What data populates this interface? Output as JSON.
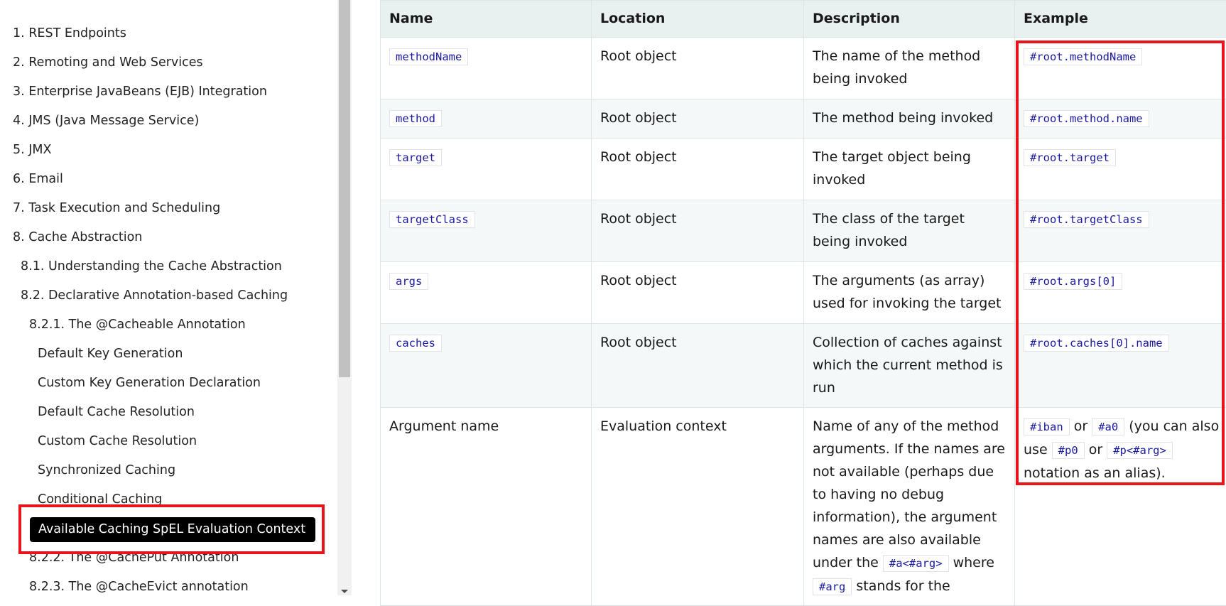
{
  "sidebar": {
    "items": [
      {
        "label": "1. REST Endpoints",
        "level": 1
      },
      {
        "label": "2. Remoting and Web Services",
        "level": 1
      },
      {
        "label": "3. Enterprise JavaBeans (EJB) Integration",
        "level": 1
      },
      {
        "label": "4. JMS (Java Message Service)",
        "level": 1
      },
      {
        "label": "5. JMX",
        "level": 1
      },
      {
        "label": "6. Email",
        "level": 1
      },
      {
        "label": "7. Task Execution and Scheduling",
        "level": 1
      },
      {
        "label": "8. Cache Abstraction",
        "level": 1
      },
      {
        "label": "8.1. Understanding the Cache Abstraction",
        "level": 2
      },
      {
        "label": "8.2. Declarative Annotation-based Caching",
        "level": 2
      },
      {
        "label": "8.2.1. The @Cacheable Annotation",
        "level": 3
      },
      {
        "label": "Default Key Generation",
        "level": 4
      },
      {
        "label": "Custom Key Generation Declaration",
        "level": 4
      },
      {
        "label": "Default Cache Resolution",
        "level": 4
      },
      {
        "label": "Custom Cache Resolution",
        "level": 4
      },
      {
        "label": "Synchronized Caching",
        "level": 4
      },
      {
        "label": "Conditional Caching",
        "level": 4
      },
      {
        "label": "Available Caching SpEL Evaluation Context",
        "level": 4,
        "active": true
      },
      {
        "label": "8.2.2. The @CachePut Annotation",
        "level": 3
      },
      {
        "label": "8.2.3. The @CacheEvict annotation",
        "level": 3
      }
    ]
  },
  "table": {
    "headers": [
      "Name",
      "Location",
      "Description",
      "Example"
    ],
    "rows": [
      {
        "name": "methodName",
        "location": "Root object",
        "description": "The name of the method being invoked",
        "example": "#root.methodName"
      },
      {
        "name": "method",
        "location": "Root object",
        "description": "The method being invoked",
        "example": "#root.method.name"
      },
      {
        "name": "target",
        "location": "Root object",
        "description": "The target object being invoked",
        "example": "#root.target"
      },
      {
        "name": "targetClass",
        "location": "Root object",
        "description": "The class of the target being invoked",
        "example": "#root.targetClass"
      },
      {
        "name": "args",
        "location": "Root object",
        "description": "The arguments (as array) used for invoking the target",
        "example": "#root.args[0]"
      },
      {
        "name": "caches",
        "location": "Root object",
        "description": "Collection of caches against which the current method is run",
        "example": "#root.caches[0].name"
      }
    ],
    "last_row": {
      "name": "Argument name",
      "location": "Evaluation context",
      "description": {
        "t1": "Name of any of the method arguments. If the names are not available (perhaps due to having no debug information), the argument names are also available under the ",
        "c1": "#a<#arg>",
        "t2": " where ",
        "c2": "#arg",
        "t3": " stands for the"
      },
      "example": {
        "c1": "#iban",
        "t1": " or ",
        "c2": "#a0",
        "t2": " (you can also use ",
        "c3": "#p0",
        "t3": " or ",
        "c4": "#p<#arg>",
        "t4": " notation as an alias)."
      }
    }
  },
  "colors": {
    "highlight": "#e8141c",
    "code_text": "#1a1aa0",
    "active_bg": "#000000"
  }
}
